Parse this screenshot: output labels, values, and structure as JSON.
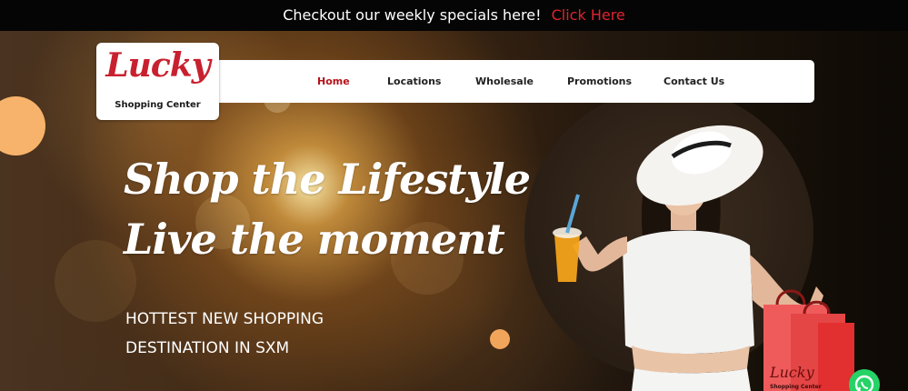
{
  "announcement": {
    "text": "Checkout our weekly specials here!",
    "link_label": "Click Here"
  },
  "logo": {
    "script_text": "Lucky",
    "subtext": "Shopping Center"
  },
  "nav": {
    "items": [
      {
        "label": "Home",
        "active": true
      },
      {
        "label": "Locations",
        "active": false
      },
      {
        "label": "Wholesale",
        "active": false
      },
      {
        "label": "Promotions",
        "active": false
      },
      {
        "label": "Contact Us",
        "active": false
      }
    ]
  },
  "hero": {
    "headline_line1": "Shop the Lifestyle,",
    "headline_line2": "Live the moment",
    "subline_line1": "HOTTEST NEW SHOPPING",
    "subline_line2": "DESTINATION IN SXM"
  },
  "bag_logo": {
    "script_text": "Lucky",
    "subtext": "Shopping Center"
  },
  "colors": {
    "brand_red": "#c8202f",
    "nav_active": "#b5121b",
    "accent_orange": "#f7b36b",
    "whatsapp_green": "#25d366"
  },
  "icons": {
    "chat": "whatsapp-icon"
  }
}
